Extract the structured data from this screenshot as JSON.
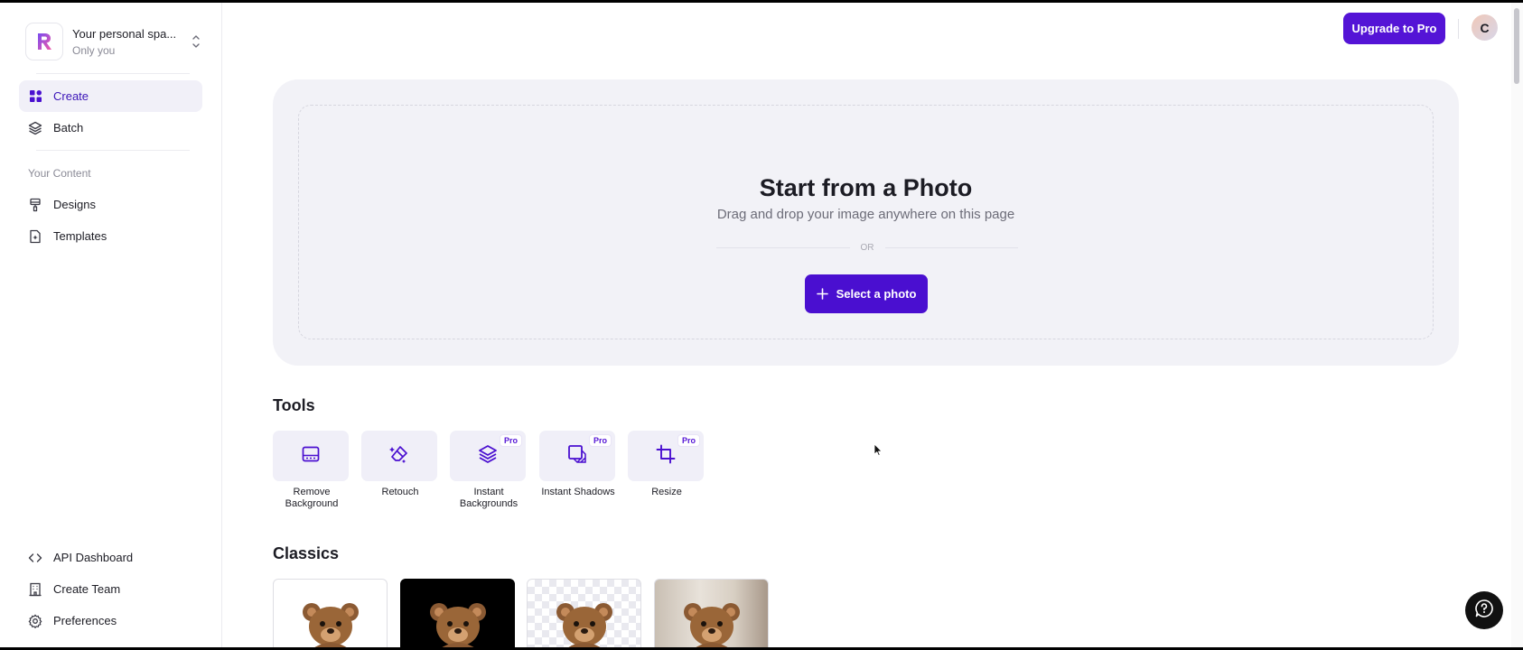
{
  "workspace": {
    "name": "Your personal spa...",
    "sub": "Only you"
  },
  "nav": {
    "create": "Create",
    "batch": "Batch",
    "section_label": "Your Content",
    "designs": "Designs",
    "templates": "Templates",
    "api": "API Dashboard",
    "team": "Create Team",
    "preferences": "Preferences"
  },
  "topbar": {
    "upgrade": "Upgrade to Pro",
    "avatar_initial": "C"
  },
  "hero": {
    "title": "Start from a Photo",
    "subtitle": "Drag and drop your image anywhere on this page",
    "or": "OR",
    "select_button": "Select a photo"
  },
  "tools": {
    "title": "Tools",
    "items": [
      {
        "label": "Remove Background",
        "pro": false,
        "icon": "remove-background-icon"
      },
      {
        "label": "Retouch",
        "pro": false,
        "icon": "eraser-icon"
      },
      {
        "label": "Instant Backgrounds",
        "pro": true,
        "icon": "layers-icon"
      },
      {
        "label": "Instant Shadows",
        "pro": true,
        "icon": "shadow-icon"
      },
      {
        "label": "Resize",
        "pro": true,
        "icon": "crop-icon"
      }
    ],
    "pro_badge": "Pro"
  },
  "classics": {
    "title": "Classics",
    "items": [
      {
        "style": "white-background"
      },
      {
        "style": "black-background"
      },
      {
        "style": "transparent-background"
      },
      {
        "style": "room-background"
      }
    ]
  },
  "colors": {
    "accent": "#5414d6",
    "button": "#4a0fd0",
    "hero_bg": "#f2f2f7"
  }
}
